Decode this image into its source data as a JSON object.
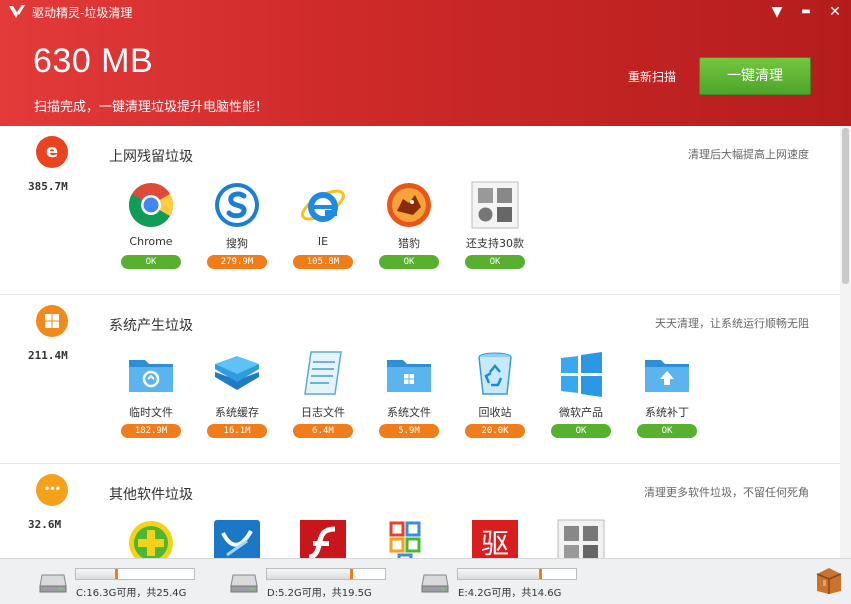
{
  "window": {
    "title": "驱动精灵-垃圾清理",
    "minimize_glyph": "▬",
    "menu_glyph": "▼",
    "close_glyph": "✕"
  },
  "header": {
    "total_size": "630 MB",
    "message": "扫描完成，一键清理垃圾提升电脑性能！",
    "rescan_label": "重新扫描",
    "clean_label": "一键清理"
  },
  "sections": [
    {
      "title": "上网残留垃圾",
      "size": "385.7M",
      "description": "清理后大幅提高上网速度",
      "icon": "ie-circle-icon",
      "icon_char": "e",
      "circle_color": "#e9441f",
      "items": [
        {
          "label": "Chrome",
          "status": "OK",
          "icon": "chrome-icon"
        },
        {
          "label": "搜狗",
          "status": "279.9M",
          "icon": "sogou-icon"
        },
        {
          "label": "IE",
          "status": "105.8M",
          "icon": "ie-icon"
        },
        {
          "label": "猎豹",
          "status": "OK",
          "icon": "liebao-icon"
        },
        {
          "label": "还支持30款",
          "status": "OK",
          "icon": "more-browsers-icon"
        }
      ]
    },
    {
      "title": "系统产生垃圾",
      "size": "211.4M",
      "description": "天天清理，让系统运行顺畅无阻",
      "icon": "windows-circle-icon",
      "icon_char": "",
      "circle_color": "#f08a1c",
      "items": [
        {
          "label": "临时文件",
          "status": "182.9M",
          "icon": "temp-folder-icon"
        },
        {
          "label": "系统缓存",
          "status": "16.1M",
          "icon": "system-cache-icon"
        },
        {
          "label": "日志文件",
          "status": "6.4M",
          "icon": "log-file-icon"
        },
        {
          "label": "系统文件",
          "status": "5.9M",
          "icon": "system-folder-icon"
        },
        {
          "label": "回收站",
          "status": "20.0K",
          "icon": "recycle-bin-icon"
        },
        {
          "label": "微软产品",
          "status": "OK",
          "icon": "microsoft-icon"
        },
        {
          "label": "系统补丁",
          "status": "OK",
          "icon": "patch-folder-icon"
        }
      ]
    },
    {
      "title": "其他软件垃圾",
      "size": "32.6M",
      "description": "清理更多软件垃圾，不留任何死角",
      "icon": "more-circle-icon",
      "icon_char": "•••",
      "circle_color": "#f5a11b",
      "items": [
        {
          "label": "",
          "status": "",
          "icon": "360-icon"
        },
        {
          "label": "",
          "status": "",
          "icon": "blue-app-icon"
        },
        {
          "label": "",
          "status": "",
          "icon": "flash-icon"
        },
        {
          "label": "",
          "status": "",
          "icon": "office-grid-icon"
        },
        {
          "label": "",
          "status": "",
          "icon": "qudong-icon"
        },
        {
          "label": "",
          "status": "",
          "icon": "gray-app-icon"
        }
      ]
    }
  ],
  "drives": [
    {
      "text": "C:16.3G可用，共25.4G",
      "used_fraction": 0.36
    },
    {
      "text": "D:5.2G可用，共19.5G",
      "used_fraction": 0.73
    },
    {
      "text": "E:4.2G可用，共14.6G",
      "used_fraction": 0.71
    }
  ],
  "colors": {
    "header": "#c82424",
    "clean_button": "#5cb532",
    "ok_badge": "#57b12f",
    "size_badge": "#f07c1a"
  }
}
